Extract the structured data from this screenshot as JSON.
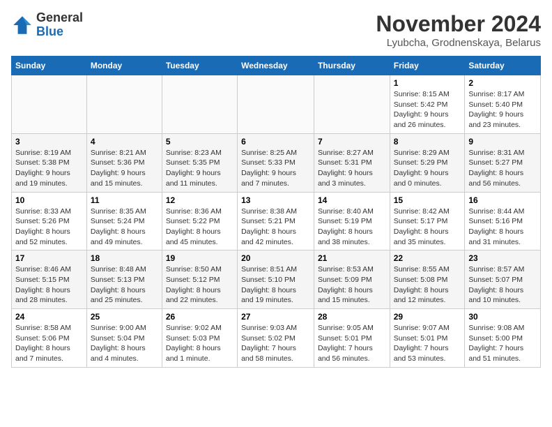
{
  "header": {
    "logo_general": "General",
    "logo_blue": "Blue",
    "month_title": "November 2024",
    "subtitle": "Lyubcha, Grodnenskaya, Belarus"
  },
  "days_of_week": [
    "Sunday",
    "Monday",
    "Tuesday",
    "Wednesday",
    "Thursday",
    "Friday",
    "Saturday"
  ],
  "weeks": [
    [
      {
        "day": "",
        "info": ""
      },
      {
        "day": "",
        "info": ""
      },
      {
        "day": "",
        "info": ""
      },
      {
        "day": "",
        "info": ""
      },
      {
        "day": "",
        "info": ""
      },
      {
        "day": "1",
        "info": "Sunrise: 8:15 AM\nSunset: 5:42 PM\nDaylight: 9 hours and 26 minutes."
      },
      {
        "day": "2",
        "info": "Sunrise: 8:17 AM\nSunset: 5:40 PM\nDaylight: 9 hours and 23 minutes."
      }
    ],
    [
      {
        "day": "3",
        "info": "Sunrise: 8:19 AM\nSunset: 5:38 PM\nDaylight: 9 hours and 19 minutes."
      },
      {
        "day": "4",
        "info": "Sunrise: 8:21 AM\nSunset: 5:36 PM\nDaylight: 9 hours and 15 minutes."
      },
      {
        "day": "5",
        "info": "Sunrise: 8:23 AM\nSunset: 5:35 PM\nDaylight: 9 hours and 11 minutes."
      },
      {
        "day": "6",
        "info": "Sunrise: 8:25 AM\nSunset: 5:33 PM\nDaylight: 9 hours and 7 minutes."
      },
      {
        "day": "7",
        "info": "Sunrise: 8:27 AM\nSunset: 5:31 PM\nDaylight: 9 hours and 3 minutes."
      },
      {
        "day": "8",
        "info": "Sunrise: 8:29 AM\nSunset: 5:29 PM\nDaylight: 9 hours and 0 minutes."
      },
      {
        "day": "9",
        "info": "Sunrise: 8:31 AM\nSunset: 5:27 PM\nDaylight: 8 hours and 56 minutes."
      }
    ],
    [
      {
        "day": "10",
        "info": "Sunrise: 8:33 AM\nSunset: 5:26 PM\nDaylight: 8 hours and 52 minutes."
      },
      {
        "day": "11",
        "info": "Sunrise: 8:35 AM\nSunset: 5:24 PM\nDaylight: 8 hours and 49 minutes."
      },
      {
        "day": "12",
        "info": "Sunrise: 8:36 AM\nSunset: 5:22 PM\nDaylight: 8 hours and 45 minutes."
      },
      {
        "day": "13",
        "info": "Sunrise: 8:38 AM\nSunset: 5:21 PM\nDaylight: 8 hours and 42 minutes."
      },
      {
        "day": "14",
        "info": "Sunrise: 8:40 AM\nSunset: 5:19 PM\nDaylight: 8 hours and 38 minutes."
      },
      {
        "day": "15",
        "info": "Sunrise: 8:42 AM\nSunset: 5:17 PM\nDaylight: 8 hours and 35 minutes."
      },
      {
        "day": "16",
        "info": "Sunrise: 8:44 AM\nSunset: 5:16 PM\nDaylight: 8 hours and 31 minutes."
      }
    ],
    [
      {
        "day": "17",
        "info": "Sunrise: 8:46 AM\nSunset: 5:15 PM\nDaylight: 8 hours and 28 minutes."
      },
      {
        "day": "18",
        "info": "Sunrise: 8:48 AM\nSunset: 5:13 PM\nDaylight: 8 hours and 25 minutes."
      },
      {
        "day": "19",
        "info": "Sunrise: 8:50 AM\nSunset: 5:12 PM\nDaylight: 8 hours and 22 minutes."
      },
      {
        "day": "20",
        "info": "Sunrise: 8:51 AM\nSunset: 5:10 PM\nDaylight: 8 hours and 19 minutes."
      },
      {
        "day": "21",
        "info": "Sunrise: 8:53 AM\nSunset: 5:09 PM\nDaylight: 8 hours and 15 minutes."
      },
      {
        "day": "22",
        "info": "Sunrise: 8:55 AM\nSunset: 5:08 PM\nDaylight: 8 hours and 12 minutes."
      },
      {
        "day": "23",
        "info": "Sunrise: 8:57 AM\nSunset: 5:07 PM\nDaylight: 8 hours and 10 minutes."
      }
    ],
    [
      {
        "day": "24",
        "info": "Sunrise: 8:58 AM\nSunset: 5:06 PM\nDaylight: 8 hours and 7 minutes."
      },
      {
        "day": "25",
        "info": "Sunrise: 9:00 AM\nSunset: 5:04 PM\nDaylight: 8 hours and 4 minutes."
      },
      {
        "day": "26",
        "info": "Sunrise: 9:02 AM\nSunset: 5:03 PM\nDaylight: 8 hours and 1 minute."
      },
      {
        "day": "27",
        "info": "Sunrise: 9:03 AM\nSunset: 5:02 PM\nDaylight: 7 hours and 58 minutes."
      },
      {
        "day": "28",
        "info": "Sunrise: 9:05 AM\nSunset: 5:01 PM\nDaylight: 7 hours and 56 minutes."
      },
      {
        "day": "29",
        "info": "Sunrise: 9:07 AM\nSunset: 5:01 PM\nDaylight: 7 hours and 53 minutes."
      },
      {
        "day": "30",
        "info": "Sunrise: 9:08 AM\nSunset: 5:00 PM\nDaylight: 7 hours and 51 minutes."
      }
    ]
  ]
}
